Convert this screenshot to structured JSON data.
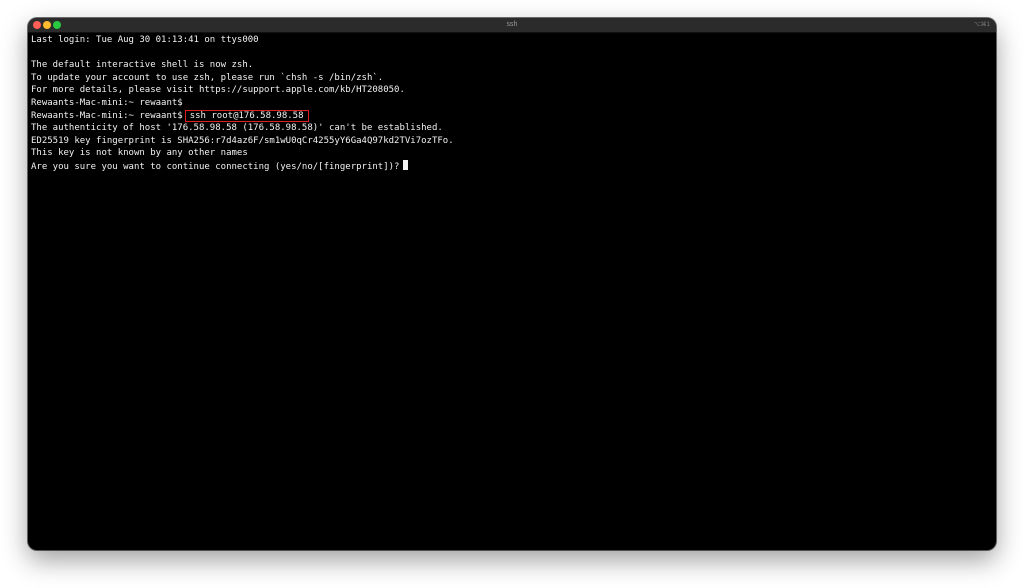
{
  "window": {
    "title": "ssh",
    "shortcut": "⌥⌘1"
  },
  "terminal": {
    "last_login": "Last login: Tue Aug 30 01:13:41 on ttys000",
    "blank": "",
    "zsh_notice_1": "The default interactive shell is now zsh.",
    "zsh_notice_2": "To update your account to use zsh, please run `chsh -s /bin/zsh`.",
    "zsh_notice_3": "For more details, please visit https://support.apple.com/kb/HT208050.",
    "prompt": "Rewaants-Mac-mini:~ rewaant$",
    "command": "ssh root@176.58.98.58",
    "authenticity": "The authenticity of host '176.58.98.58 (176.58.98.58)' can't be established.",
    "fingerprint": "ED25519 key fingerprint is SHA256:r7d4az6F/sm1wU0qCr4255yY6Ga4Q97kd2TVi7ozTFo.",
    "unknown_key": "This key is not known by any other names",
    "confirm_prompt": "Are you sure you want to continue connecting (yes/no/[fingerprint])?"
  },
  "colors": {
    "terminal_bg": "#000000",
    "terminal_fg": "#f2f2f2",
    "highlight_box": "#e02020",
    "close": "#fe5f57",
    "minimize": "#febc2e",
    "zoom": "#28c840"
  }
}
